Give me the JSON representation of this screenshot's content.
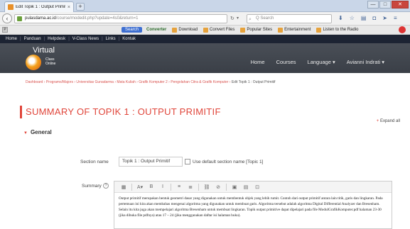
{
  "browser": {
    "tab_title": "Edit Topik 1 : Output Primitif",
    "tab_close": "×",
    "new_tab": "+",
    "url_host": "pulasdama.ac.id",
    "url_rest": "/course/modedit.php?update=4s0&return=1",
    "search_placeholder": "Q Search",
    "win_min": "—",
    "win_max": "□",
    "win_close": "✕"
  },
  "bookmarks": {
    "search_label": "Search",
    "converter_label": "Converter",
    "items": [
      "Download",
      "Convert Files",
      "Popular Sites",
      "Entertainment",
      "Listen to the Radio"
    ]
  },
  "site": {
    "top_links": [
      "Home",
      "Panduan",
      "Helpdesk",
      "V-Class News",
      "Links",
      "Kontak"
    ],
    "logo_title": "Virtual",
    "logo_sub1": "Class",
    "logo_sub2": "Online",
    "nav": [
      "Home",
      "Courses",
      "Language ▾",
      "Avianni Indrati ▾"
    ]
  },
  "breadcrumb": {
    "path": "Dashboard › Programs/Majors › Universitas Gunadarma › Mata Kuliah › Grafik Komputer 2 › Pengolahan Citra & Grafik Komputer › ",
    "current": "Edit Topik 1 : Output Primitif"
  },
  "page": {
    "title": "SUMMARY OF TOPIK 1 : OUTPUT PRIMITIF",
    "expand_all": "Expand all",
    "general": "General"
  },
  "form": {
    "section_name_label": "Section name",
    "section_name_value": "Topik 1 : Output Primitif",
    "use_default_label": "Use default section name [Topic 1]",
    "summary_label": "Summary",
    "summary_text": "Output primitif merupakan bentuk geometri dasar yang digunakan untuk membentuk objek yang lebih rumit. Contoh dari output primitif antara lain titik, garis dan lingkaran. Pada pertemuan ini kita akan membahas mengenai algoritma yang digunakan untuk membuat garis. Algoritma tersebut adalah algoritma Digital Differential Analyzer dan Bresenham. Selain itu kita juga akan mempelajari algoritma Bresenham untuk membuat lingkaran. Topik output primitive dapat dipelajari pada file ModulGrafikKomputer.pdf halaman 23-30 (jika dibuka file pdfnya) atau 17 – 24 (jika menggunakan daftar isi halaman buku)."
  },
  "editor_toolbar": [
    "▦",
    "A▾",
    "B",
    "I",
    "≡",
    "≣",
    "⛓",
    "⊘",
    "▣",
    "▤",
    "⊡"
  ]
}
